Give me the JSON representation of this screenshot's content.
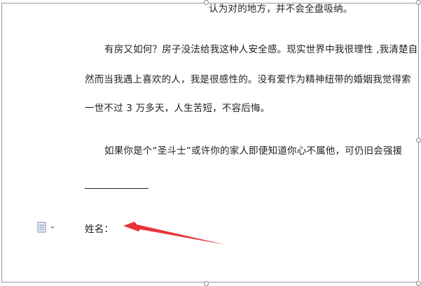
{
  "document": {
    "line1": "认为对的地方，并不会全盘吸纳。",
    "line2": "有房又如何？房子没法给我这种人安全感。现实世界中我很理性 ,我清楚自",
    "line3": "然而当我遇上喜欢的人，我是很感性的。没有爱作为精神纽带的婚姻我觉得索",
    "line4": "一世不过 3 万多天，人生苦短，不容后悔。",
    "line5": "如果你是个“圣斗士”或许你的家人即便知道你心不属他，可仍旧会强援",
    "name_label": "姓名："
  },
  "annotation": {
    "arrow_color": "#e8333a"
  },
  "icons": {
    "paste_options": "paste-options-icon"
  }
}
